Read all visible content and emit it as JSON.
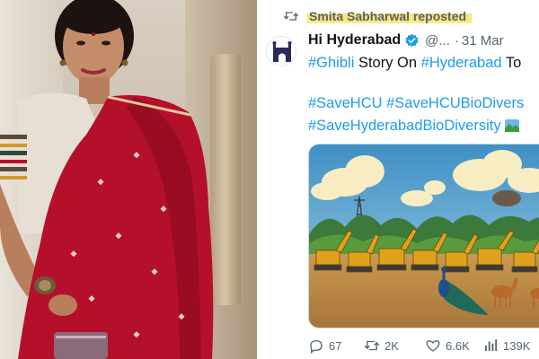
{
  "repost": {
    "reposted_by": "Smita Sabharwal reposted"
  },
  "author": {
    "name": "Hi Hyderabad",
    "handle": "@...",
    "separator": "·",
    "date": "31 Mar"
  },
  "text": {
    "line1": [
      {
        "t": "#Ghibli",
        "tag": true
      },
      {
        "t": " Story On ",
        "tag": false
      },
      {
        "t": "#Hyderabad",
        "tag": true
      },
      {
        "t": " To",
        "tag": false
      }
    ],
    "line2": "#SaveHCU #SaveHCUBioDivers",
    "line3": "#SaveHyderabadBioDiversity"
  },
  "actions": {
    "replies": "67",
    "reposts": "2K",
    "likes": "6.6K",
    "views": "139K"
  },
  "colors": {
    "link": "#1d9bf0",
    "muted": "#536471",
    "highlight": "#fbe26b",
    "saree": "#b5102a"
  },
  "icons": [
    "repost-icon",
    "verified-icon",
    "flag-icon",
    "reply-icon",
    "like-icon",
    "views-icon"
  ]
}
